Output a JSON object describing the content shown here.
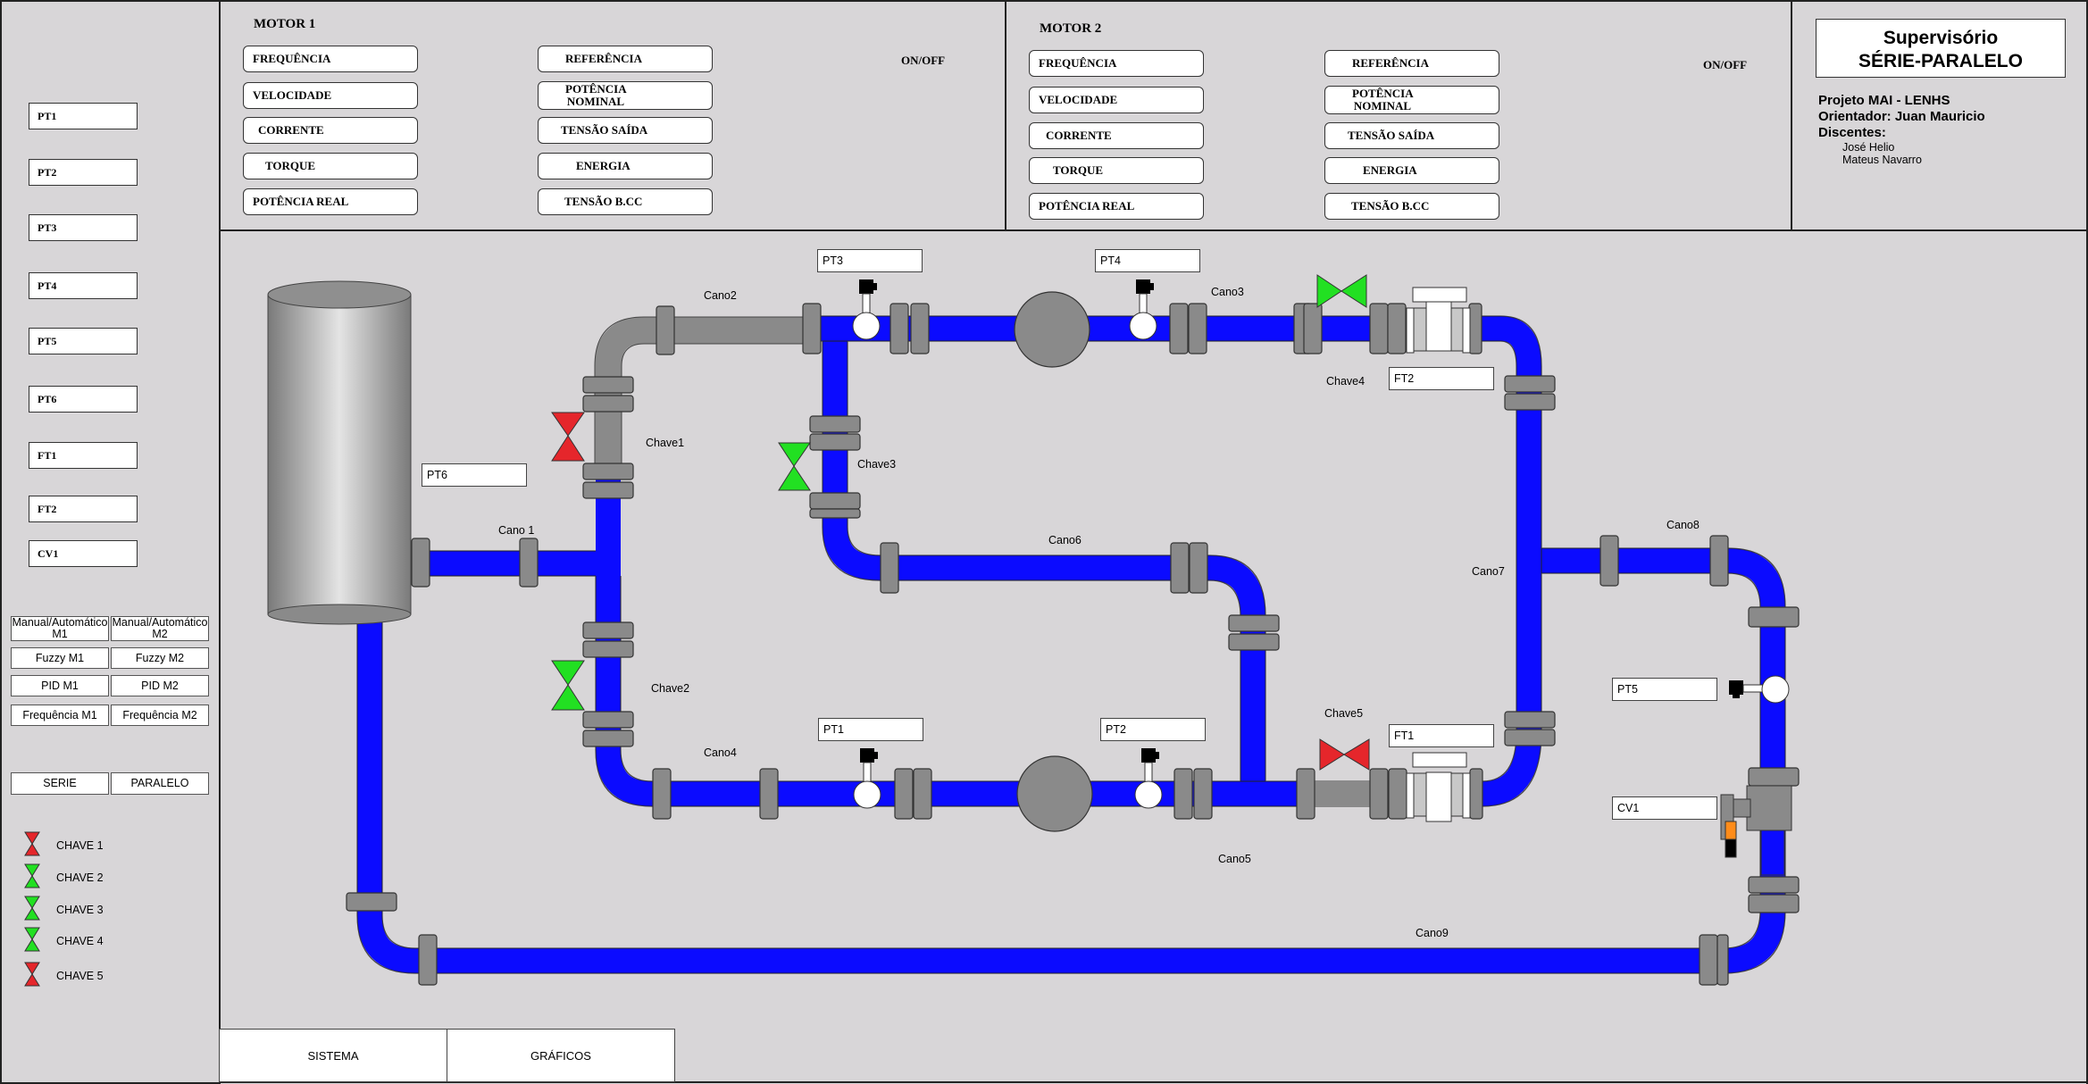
{
  "sidebar": {
    "sensors": [
      "PT1",
      "PT2",
      "PT3",
      "PT4",
      "PT5",
      "PT6",
      "FT1",
      "FT2",
      "CV1"
    ],
    "modes": {
      "manual_m1": "Manual/Automático M1",
      "manual_m2": "Manual/Automático M2",
      "fuzzy_m1": "Fuzzy M1",
      "fuzzy_m2": "Fuzzy M2",
      "pid_m1": "PID M1",
      "pid_m2": "PID M2",
      "freq_m1": "Frequência M1",
      "freq_m2": "Frequência M2",
      "serie": "SERIE",
      "paralelo": "PARALELO"
    },
    "legend": [
      {
        "label": "CHAVE 1",
        "color": "#e5262b"
      },
      {
        "label": "CHAVE 2",
        "color": "#22e022"
      },
      {
        "label": "CHAVE 3",
        "color": "#22e022"
      },
      {
        "label": "CHAVE 4",
        "color": "#22e022"
      },
      {
        "label": "CHAVE 5",
        "color": "#e5262b"
      }
    ]
  },
  "motor1": {
    "title": "MOTOR 1",
    "onoff": "ON/OFF",
    "left_fields": [
      "FREQUÊNCIA",
      "VELOCIDADE",
      "CORRENTE",
      "TORQUE",
      "POTÊNCIA REAL"
    ],
    "right_fields": [
      "REFERÊNCIA",
      "POTÊNCIA NOMINAL",
      "TENSÃO SAÍDA",
      "ENERGIA",
      "TENSÃO B.CC"
    ]
  },
  "motor2": {
    "title": "MOTOR 2",
    "onoff": "ON/OFF",
    "left_fields": [
      "FREQUÊNCIA",
      "VELOCIDADE",
      "CORRENTE",
      "TORQUE",
      "POTÊNCIA REAL"
    ],
    "right_fields": [
      "REFERÊNCIA",
      "POTÊNCIA NOMINAL",
      "TENSÃO SAÍDA",
      "ENERGIA",
      "TENSÃO B.CC"
    ]
  },
  "header": {
    "title_line1": "Supervisório",
    "title_line2": "SÉRIE-PARALELO",
    "project": "Projeto MAI - LENHS",
    "advisor": "Orientador: Juan Mauricio",
    "students_label": "Discentes:",
    "student1": "José Helio",
    "student2": "Mateus Navarro"
  },
  "diagram": {
    "pipes": {
      "cano1": "Cano 1",
      "cano2": "Cano2",
      "cano3": "Cano3",
      "cano4": "Cano4",
      "cano5": "Cano5",
      "cano6": "Cano6",
      "cano7": "Cano7",
      "cano8": "Cano8",
      "cano9": "Cano9"
    },
    "valves": {
      "chave1": "Chave1",
      "chave2": "Chave2",
      "chave3": "Chave3",
      "chave4": "Chave4",
      "chave5": "Chave5"
    },
    "sensors": {
      "pt1": "PT1",
      "pt2": "PT2",
      "pt3": "PT3",
      "pt4": "PT4",
      "pt5": "PT5",
      "pt6": "PT6",
      "ft1": "FT1",
      "ft2": "FT2",
      "cv1": "CV1"
    },
    "colors": {
      "active_pipe": "#0b0bff",
      "inactive_pipe": "#8a8a8a",
      "valve_open": "#22e022",
      "valve_closed": "#e5262b"
    }
  },
  "tabs": {
    "sistema": "SISTEMA",
    "graficos": "GRÁFICOS"
  }
}
